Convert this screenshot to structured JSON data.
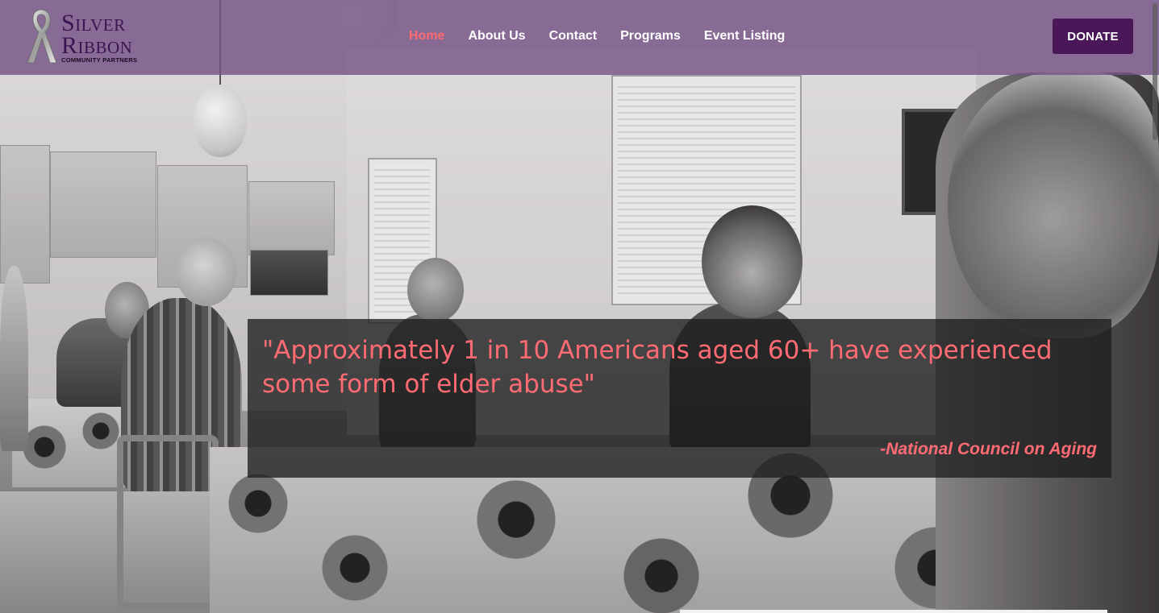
{
  "brand": {
    "line1": "Silver",
    "line2": "Ribbon",
    "tagline": "COMMUNITY PARTNERS",
    "logo_icon": "silver-ribbon-icon"
  },
  "nav": {
    "items": [
      {
        "label": "Home",
        "active": true
      },
      {
        "label": "About Us",
        "active": false
      },
      {
        "label": "Contact",
        "active": false
      },
      {
        "label": "Programs",
        "active": false
      },
      {
        "label": "Event Listing",
        "active": false
      }
    ],
    "donate_label": "DONATE"
  },
  "hero": {
    "quote": "\"Approximately 1 in 10 Americans aged 60+ have experienced some form of elder abuse\"",
    "source": "-National Council on Aging"
  },
  "colors": {
    "header_bg": "#785587",
    "accent": "#ff6b73",
    "donate_bg": "#4a1758",
    "brand_text": "#3b1552"
  }
}
